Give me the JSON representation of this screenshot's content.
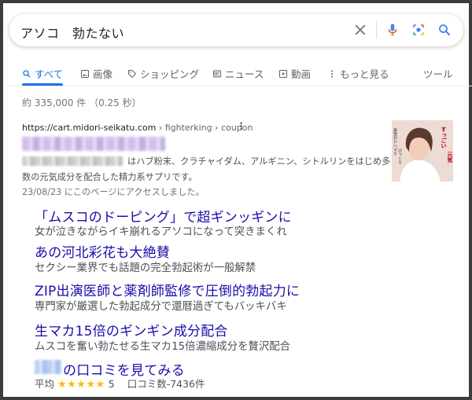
{
  "search": {
    "query": "アソコ　勃たない",
    "colors": {
      "clear": "#70757a",
      "mic_blue": "#4285f4",
      "mic_red": "#ea4335",
      "lens": "#4285f4",
      "search": "#4285f4"
    }
  },
  "tabs": [
    {
      "label": "すべて",
      "icon": "search-icon",
      "active": true
    },
    {
      "label": "画像",
      "icon": "image-icon"
    },
    {
      "label": "ショッピング",
      "icon": "tag-icon"
    },
    {
      "label": "ニュース",
      "icon": "news-icon"
    },
    {
      "label": "動画",
      "icon": "play-icon"
    },
    {
      "label": "もっと見る",
      "icon": "more-icon"
    }
  ],
  "tools_label": "ツール",
  "result_stats": "約 335,000 件 （0.25 秒）",
  "result": {
    "url_domain": "https://cart.midori-seikatu.com",
    "url_path": " › fighterking › coupon",
    "snippet_line1": "はハブ粉末、クラチャイダム、アルギニン、シトルリンをはじめ多",
    "snippet_line2": "数の元気成分を配合した精力系サプリです。",
    "visited": "23/08/23 にこのページにアクセスしました。",
    "thumbnail": {
      "accent": "#e8132b",
      "caption_white": "男性がドハマりしてびっくり",
      "caption_red": "すっごい元気"
    }
  },
  "sitelinks": [
    {
      "title": "「ムスコのドーピング」で超ギンッギンに",
      "desc": "女が泣きながらイキ崩れるアソコになって突きまくれ"
    },
    {
      "title": "あの河北彩花も大絶賛",
      "desc": "セクシー業界でも話題の完全勃起術が一般解禁"
    },
    {
      "title": "ZIP出演医師と薬剤師監修で圧倒的勃起力に",
      "desc": "専門家が厳選した勃起成分で還暦過ぎてもバッキバキ"
    },
    {
      "title": "生マカ15倍のギンギン成分配合",
      "desc": "ムスコを奮い勃たせる生マカ15倍濃縮成分を贅沢配合"
    },
    {
      "title": "の口コミを見てみる",
      "desc": ""
    }
  ],
  "rating": {
    "prefix": "平均",
    "stars": "★★★★★",
    "score": "5",
    "reviews": "口コミ数-7436件"
  }
}
